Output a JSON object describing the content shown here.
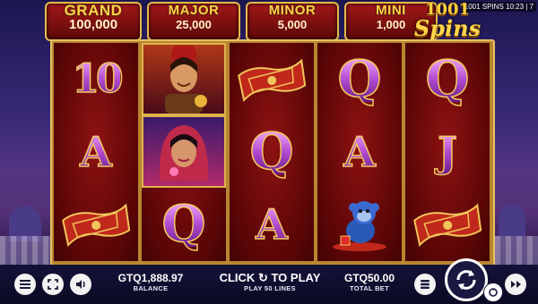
{
  "window": {
    "status": "1001 SPINS 10:23 | 7"
  },
  "jackpots": [
    {
      "name": "GRAND",
      "value": "100,000"
    },
    {
      "name": "MAJOR",
      "value": "25,000"
    },
    {
      "name": "MINOR",
      "value": "5,000"
    },
    {
      "name": "MINI",
      "value": "1,000"
    }
  ],
  "logo": {
    "line1": "1001",
    "line2": "Spins"
  },
  "reels": [
    [
      "10",
      "A",
      "carpet"
    ],
    [
      "aladdin",
      "princess",
      "Q"
    ],
    [
      "carpet",
      "Q",
      "A"
    ],
    [
      "Q",
      "A",
      "monkey"
    ],
    [
      "Q",
      "J",
      "carpet"
    ]
  ],
  "bottom": {
    "balance_value": "GTQ1,888.97",
    "balance_label": "BALANCE",
    "play_prompt_left": "CLICK",
    "play_prompt_right": "TO PLAY",
    "lines_text": "PLAY 50 LINES",
    "bet_value": "GTQ50.00",
    "bet_label": "TOTAL BET"
  },
  "icons": [
    "menu-icon",
    "fullscreen-icon",
    "sound-icon",
    "coin-stack-icon",
    "spin-icon",
    "autoplay-icon",
    "fast-forward-icon",
    "refresh-icon"
  ],
  "colors": {
    "accent_gold": "#e8b84a",
    "jackpot_red": "#a31818",
    "reel_red": "#5c0606"
  }
}
